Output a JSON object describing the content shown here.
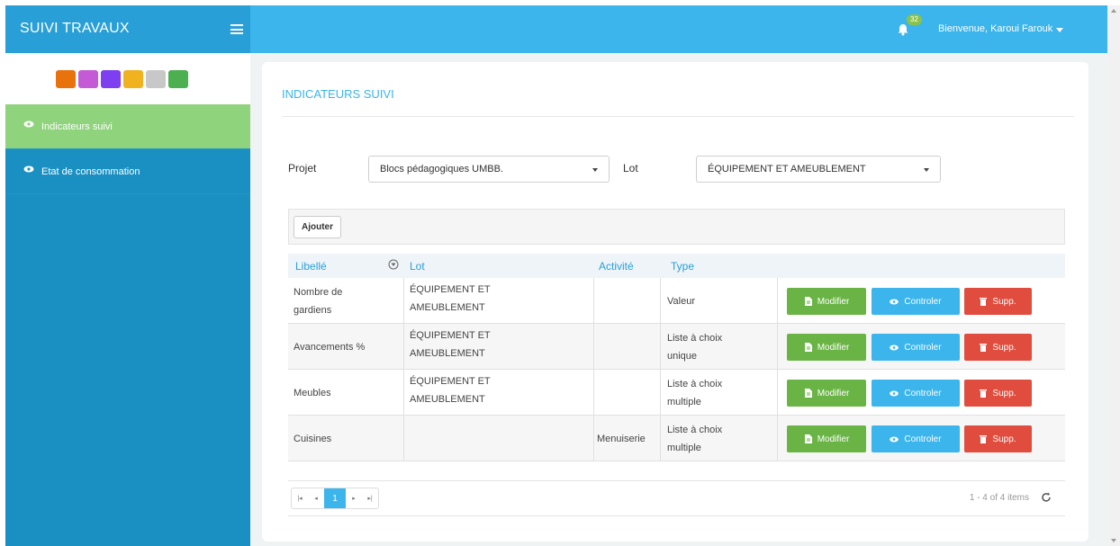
{
  "app": {
    "title": "SUIVI TRAVAUX",
    "notification_count": "32",
    "user_greeting": "Bienvenue, Karoui Farouk"
  },
  "sidebar": {
    "logo_colors": [
      "#e8720c",
      "#c45ad6",
      "#7d3ff0",
      "#f0b21e",
      "#c8c8c8",
      "#4caf50"
    ],
    "items": [
      {
        "label": "Indicateurs suivi",
        "active": true
      },
      {
        "label": "Etat de consommation",
        "active": false
      }
    ]
  },
  "main": {
    "page_title": "INDICATEURS SUIVI",
    "filters": {
      "projet_label": "Projet",
      "projet_value": "Blocs pédagogiques UMBB.",
      "lot_label": "Lot",
      "lot_value": "ÉQUIPEMENT ET AMEUBLEMENT"
    },
    "add_button": "Ajouter",
    "table": {
      "columns": [
        "Libellé",
        "Lot",
        "Activité",
        "Type"
      ],
      "row_actions": {
        "modify": "Modifier",
        "control": "Controler",
        "delete": "Supp."
      },
      "rows": [
        {
          "libelle_1": "Nombre de",
          "libelle_2": "gardiens",
          "lot_1": "ÉQUIPEMENT ET",
          "lot_2": "AMEUBLEMENT",
          "activite": "",
          "type_1": "Valeur",
          "type_2": ""
        },
        {
          "libelle_1": "Avancements %",
          "libelle_2": "",
          "lot_1": "ÉQUIPEMENT ET",
          "lot_2": "AMEUBLEMENT",
          "activite": "",
          "type_1": "Liste à choix",
          "type_2": "unique"
        },
        {
          "libelle_1": "Meubles",
          "libelle_2": "",
          "lot_1": "ÉQUIPEMENT ET",
          "lot_2": "AMEUBLEMENT",
          "activite": "",
          "type_1": "Liste à choix",
          "type_2": "multiple"
        },
        {
          "libelle_1": "Cuisines",
          "libelle_2": "",
          "lot_1": "",
          "lot_2": "",
          "activite": "Menuiserie",
          "type_1": "Liste à choix",
          "type_2": "multiple"
        }
      ]
    },
    "pager": {
      "current_page": "1",
      "info": "1 - 4 of 4 items"
    }
  },
  "colors": {
    "topbar": "#3bb5ec",
    "sidebar": "#1a8fc2",
    "sidebar_active": "#8fd37c",
    "modify": "#6ab445",
    "control": "#3bb5ec",
    "delete": "#e04c3d"
  }
}
